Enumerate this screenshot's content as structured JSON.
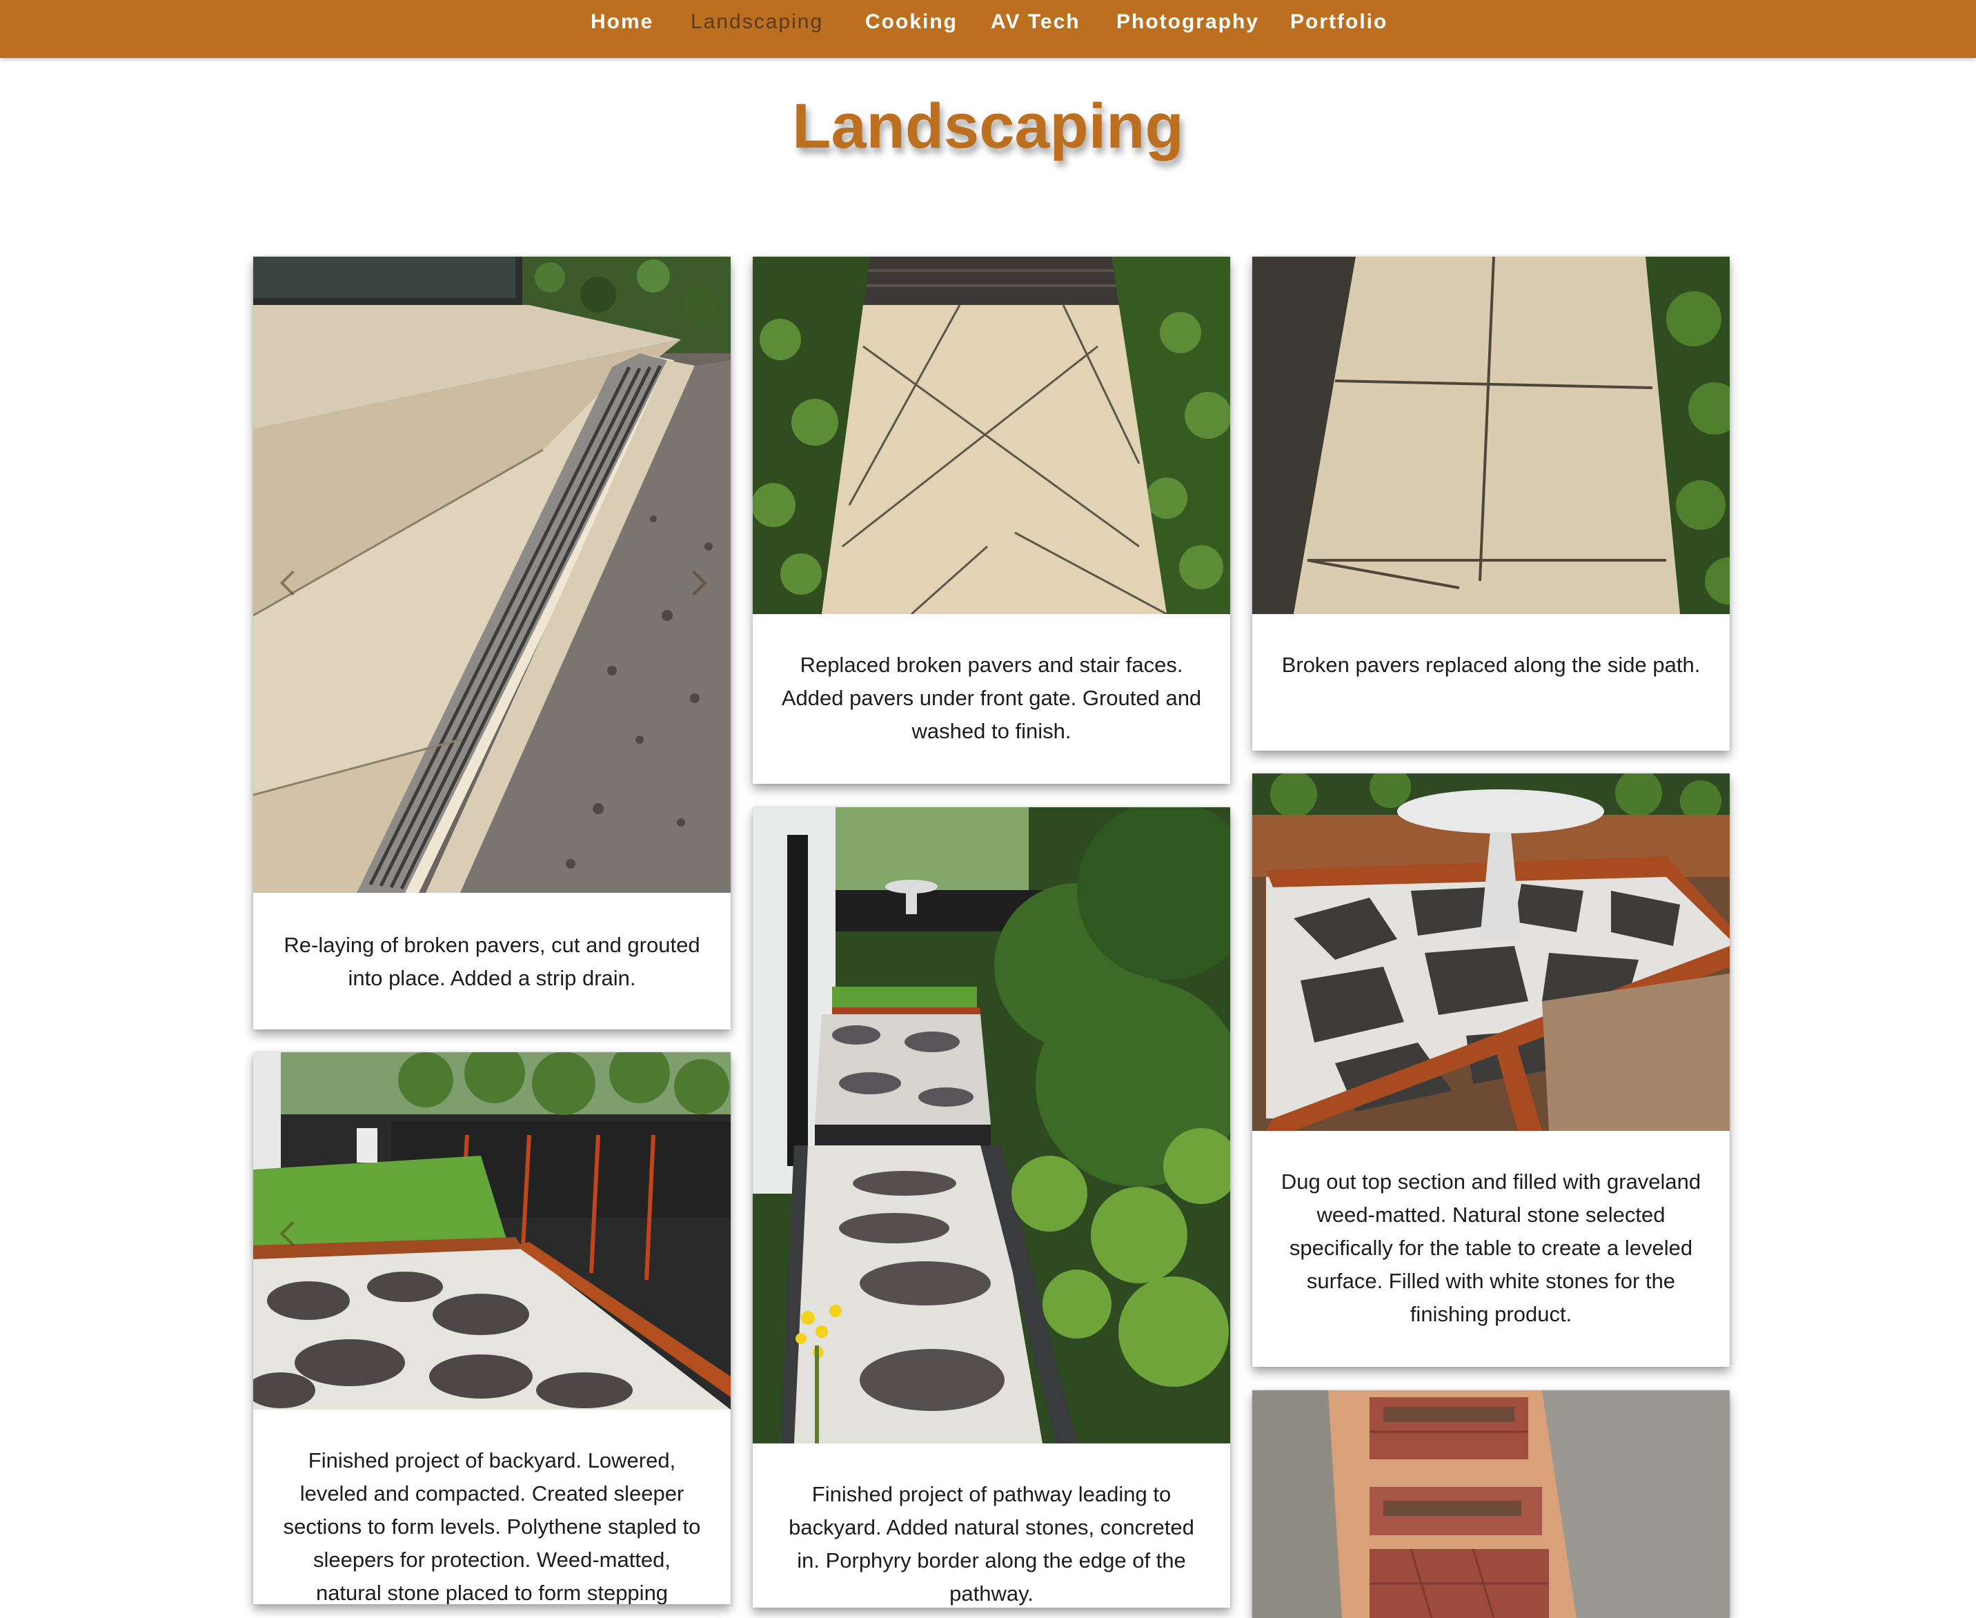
{
  "nav": {
    "items": [
      {
        "label": "Home"
      },
      {
        "label": "Landscaping",
        "active": true
      },
      {
        "label": "Cooking"
      },
      {
        "label": "AV Tech"
      },
      {
        "label": "Photography"
      },
      {
        "label": "Portfolio"
      }
    ]
  },
  "page": {
    "title": "Landscaping"
  },
  "colors": {
    "accent": "#bc6f1f",
    "nav_active": "#5a3a1c",
    "caption_text": "#1c1c1c"
  },
  "gallery": {
    "cards": [
      {
        "caption": "Re-laying of broken pavers, cut and grouted into place. Added a strip drain."
      },
      {
        "caption": "Replaced broken pavers and stair faces. Added pavers under front gate. Grouted and washed to finish."
      },
      {
        "caption": "Broken pavers replaced along the side path."
      },
      {
        "caption": "Finished project of backyard. Lowered, leveled and compacted. Created sleeper sections to form levels. Polythene stapled to sleepers for protection. Weed-matted, natural stone placed to form stepping"
      },
      {
        "caption": "Finished project of pathway leading to backyard. Added natural stones, concreted in. Porphyry border along the edge of the pathway."
      },
      {
        "caption": "Dug out top section and filled with graveland weed-matted. Natural stone selected specifically for the table to create a leveled surface. Filled with white stones for the finishing product."
      },
      {
        "caption": ""
      }
    ]
  }
}
